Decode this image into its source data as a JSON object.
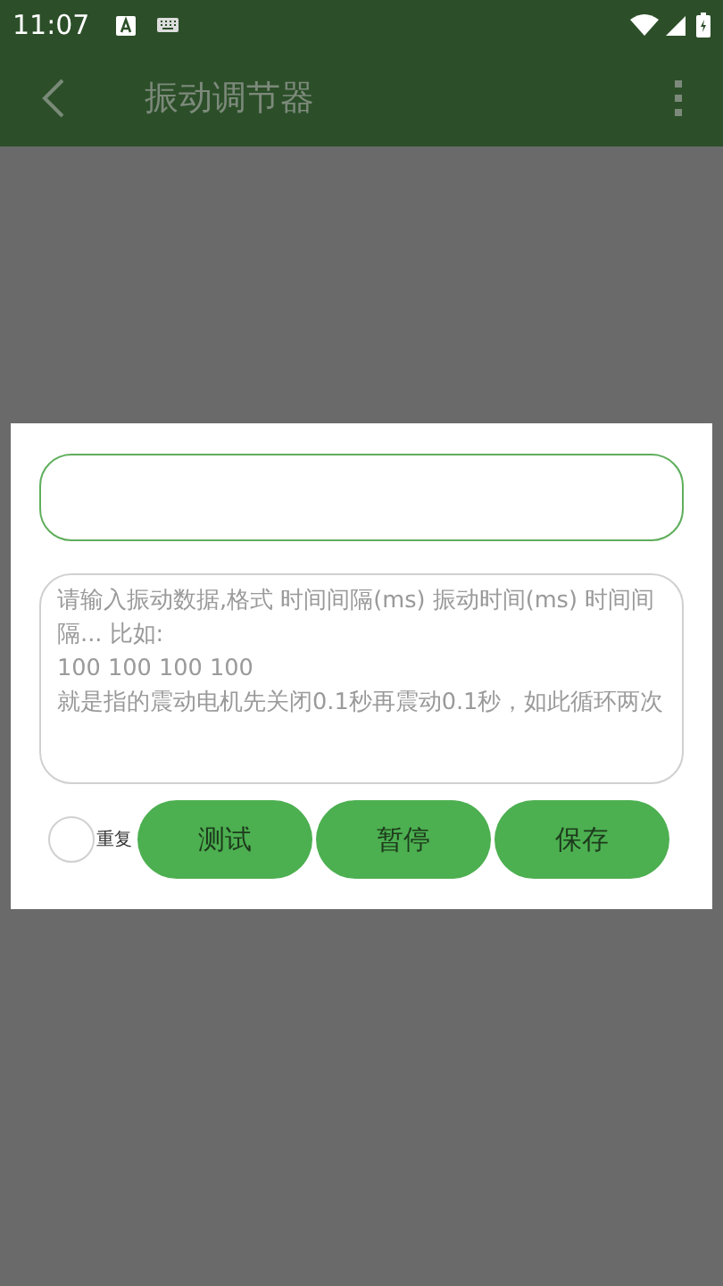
{
  "status_bar": {
    "time": "11:07"
  },
  "app_bar": {
    "title": "振动调节器"
  },
  "dialog": {
    "data_field": {
      "placeholder": "请输入振动数据,格式 时间间隔(ms) 振动时间(ms) 时间间隔... 比如:\n100 100 100 100\n就是指的震动电机先关闭0.1秒再震动0.1秒，如此循环两次"
    },
    "repeat": {
      "label": "重复",
      "checked": false
    },
    "buttons": [
      {
        "label": "测试"
      },
      {
        "label": "暂停"
      },
      {
        "label": "保存"
      }
    ]
  }
}
